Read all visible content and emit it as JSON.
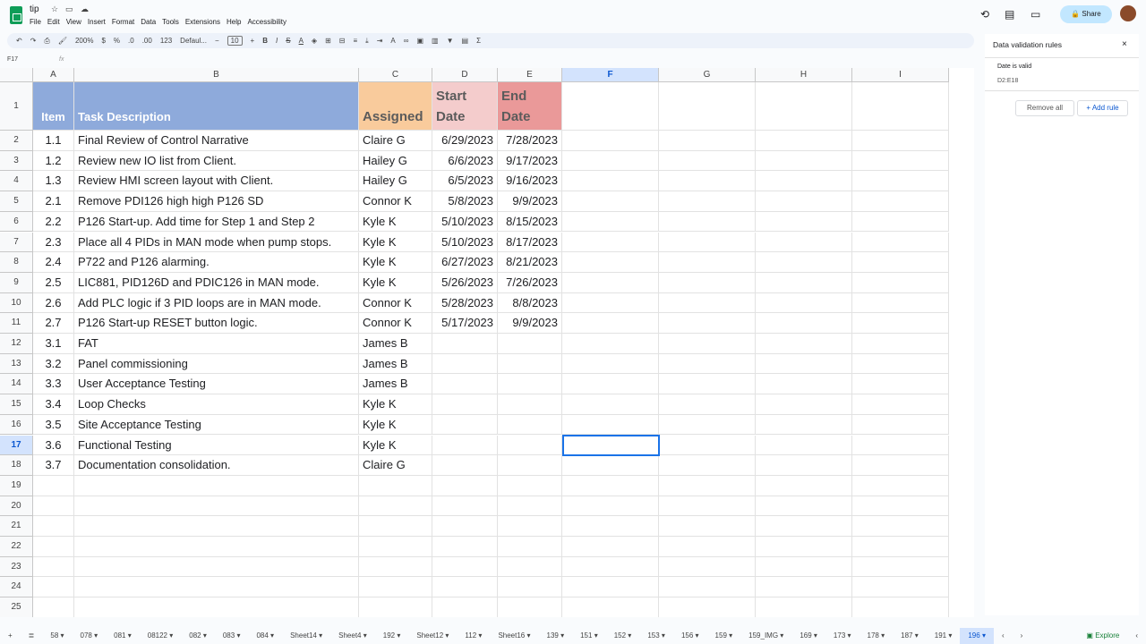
{
  "doc": {
    "title": "tip",
    "menu": [
      "File",
      "Edit",
      "View",
      "Insert",
      "Format",
      "Data",
      "Tools",
      "Extensions",
      "Help",
      "Accessibility"
    ]
  },
  "toolbar": {
    "zoom": "200%",
    "currency": "$",
    "percent": "%",
    "dec_less": ".0",
    "dec_more": ".00",
    "number_format": "123",
    "font": "Defaul...",
    "font_size": "10",
    "minus": "−",
    "plus": "+",
    "bold": "B",
    "italic": "I",
    "strike": "S",
    "text_color": "A",
    "sum": "Σ"
  },
  "formula_bar": {
    "cell_ref": "F17",
    "fx": "fx"
  },
  "header": {
    "share": "Share"
  },
  "columns": [
    "A",
    "B",
    "C",
    "D",
    "E",
    "F",
    "G",
    "H",
    "I"
  ],
  "selected_cell": "F17",
  "header_row": {
    "a": "Item",
    "b": "Task Description",
    "c": "Assigned",
    "d": "Start Date",
    "e": "End Date"
  },
  "header_colors": {
    "ab": "#8eaadb",
    "c": "#f9cb9c",
    "d": "#f4cccc",
    "e": "#ea9999"
  },
  "rows": [
    [
      "1.1",
      "Final Review of Control Narrative",
      "Claire G",
      "6/29/2023",
      "7/28/2023"
    ],
    [
      "1.2",
      "Review new IO list from Client.",
      "Hailey G",
      "6/6/2023",
      "9/17/2023"
    ],
    [
      "1.3",
      "Review HMI screen layout with Client.",
      "Hailey G",
      "6/5/2023",
      "9/16/2023"
    ],
    [
      "2.1",
      "Remove PDI126 high high P126 SD",
      "Connor K",
      "5/8/2023",
      "9/9/2023"
    ],
    [
      "2.2",
      "P126 Start-up. Add time for Step 1 and Step 2",
      "Kyle K",
      "5/10/2023",
      "8/15/2023"
    ],
    [
      "2.3",
      "Place all 4 PIDs in MAN mode when pump stops.",
      "Kyle K",
      "5/10/2023",
      "8/17/2023"
    ],
    [
      "2.4",
      "P722 and P126 alarming.",
      "Kyle K",
      "6/27/2023",
      "8/21/2023"
    ],
    [
      "2.5",
      "LIC881, PID126D and PDIC126 in MAN mode.",
      "Kyle K",
      "5/26/2023",
      "7/26/2023"
    ],
    [
      "2.6",
      "Add PLC logic if 3 PID loops are in MAN mode.",
      "Connor K",
      "5/28/2023",
      "8/8/2023"
    ],
    [
      "2.7",
      "P126 Start-up RESET button logic.",
      "Connor K",
      "5/17/2023",
      "9/9/2023"
    ],
    [
      "3.1",
      "FAT",
      "James B",
      "",
      ""
    ],
    [
      "3.2",
      "Panel commissioning",
      "James B",
      "",
      ""
    ],
    [
      "3.3",
      "User Acceptance Testing",
      "James B",
      "",
      ""
    ],
    [
      "3.4",
      "Loop Checks",
      "Kyle K",
      "",
      ""
    ],
    [
      "3.5",
      "Site Acceptance Testing",
      "Kyle K",
      "",
      ""
    ],
    [
      "3.6",
      "Functional Testing",
      "Kyle K",
      "",
      ""
    ],
    [
      "3.7",
      "Documentation consolidation.",
      "Claire G",
      "",
      ""
    ]
  ],
  "row_numbers": [
    "1",
    "2",
    "3",
    "4",
    "5",
    "6",
    "7",
    "8",
    "9",
    "10",
    "11",
    "12",
    "13",
    "14",
    "15",
    "16",
    "17",
    "18",
    "19",
    "20",
    "21",
    "22",
    "23",
    "24",
    "25"
  ],
  "panel": {
    "title": "Data validation rules",
    "rule_name": "Date is valid",
    "rule_range": "D2:E18",
    "remove_all": "Remove all",
    "add_rule": "Add rule"
  },
  "sheet_tabs": [
    "58",
    "078",
    "081",
    "08122",
    "082",
    "083",
    "084",
    "Sheet14",
    "Sheet4",
    "192",
    "Sheet12",
    "112",
    "Sheet16",
    "139",
    "151",
    "152",
    "153",
    "156",
    "159",
    "159_IMG",
    "169",
    "173",
    "178",
    "187",
    "191",
    "196"
  ],
  "active_tab": "196",
  "explore": "Explore"
}
